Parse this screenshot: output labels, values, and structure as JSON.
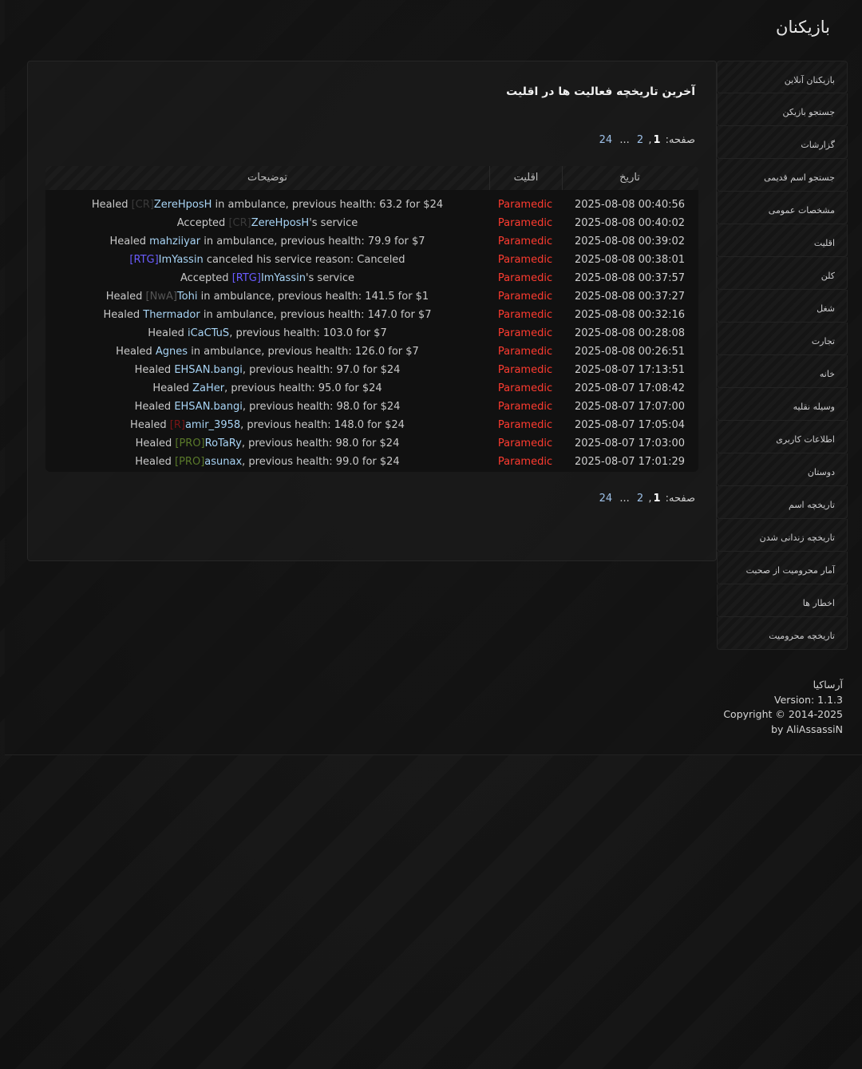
{
  "page": {
    "title": "بازیکنان"
  },
  "main": {
    "heading": "آخرین تاریخچه فعالیت ها در اقلیت",
    "pagination": {
      "label": "صفحه:",
      "current": "1",
      "comma": ",",
      "next": "2",
      "ellipsis": "...",
      "last": "24"
    },
    "table": {
      "headers": {
        "desc": "توضیحات",
        "faction": "اقلیت",
        "date": "تاریخ"
      },
      "rows": [
        {
          "parts": [
            {
              "t": "Healed "
            },
            {
              "t": "[CR]",
              "c": "#3a3a3a"
            },
            {
              "t": "ZereHposH",
              "c": "#a8d4f5"
            },
            {
              "t": " in ambulance, previous health: 63.2 for $24"
            }
          ],
          "faction": "Paramedic",
          "date": "2025-08-08 00:40:56"
        },
        {
          "parts": [
            {
              "t": "Accepted "
            },
            {
              "t": "[CR]",
              "c": "#3a3a3a"
            },
            {
              "t": "ZereHposH",
              "c": "#a8d4f5"
            },
            {
              "t": "'s service"
            }
          ],
          "faction": "Paramedic",
          "date": "2025-08-08 00:40:02"
        },
        {
          "parts": [
            {
              "t": "Healed "
            },
            {
              "t": "mahziiyar",
              "c": "#a8d4f5"
            },
            {
              "t": " in ambulance, previous health: 79.9 for $7"
            }
          ],
          "faction": "Paramedic",
          "date": "2025-08-08 00:39:02"
        },
        {
          "parts": [
            {
              "t": "[RTG]",
              "c": "#6a5cff"
            },
            {
              "t": "ImYassin",
              "c": "#a8d4f5"
            },
            {
              "t": " canceled his service reason: Canceled"
            }
          ],
          "faction": "Paramedic",
          "date": "2025-08-08 00:38:01"
        },
        {
          "parts": [
            {
              "t": "Accepted "
            },
            {
              "t": "[RTG]",
              "c": "#6a5cff"
            },
            {
              "t": "ImYassin",
              "c": "#a8d4f5"
            },
            {
              "t": "'s service"
            }
          ],
          "faction": "Paramedic",
          "date": "2025-08-08 00:37:57"
        },
        {
          "parts": [
            {
              "t": "Healed "
            },
            {
              "t": "[NwA]",
              "c": "#555555"
            },
            {
              "t": "Tohi",
              "c": "#a8d4f5"
            },
            {
              "t": " in ambulance, previous health: 141.5 for $1"
            }
          ],
          "faction": "Paramedic",
          "date": "2025-08-08 00:37:27"
        },
        {
          "parts": [
            {
              "t": "Healed "
            },
            {
              "t": "Thermador",
              "c": "#a8d4f5"
            },
            {
              "t": " in ambulance, previous health: 147.0 for $7"
            }
          ],
          "faction": "Paramedic",
          "date": "2025-08-08 00:32:16"
        },
        {
          "parts": [
            {
              "t": "Healed "
            },
            {
              "t": "iCaCTuS",
              "c": "#a8d4f5"
            },
            {
              "t": ", previous health: 103.0 for $7"
            }
          ],
          "faction": "Paramedic",
          "date": "2025-08-08 00:28:08"
        },
        {
          "parts": [
            {
              "t": "Healed "
            },
            {
              "t": "Agnes",
              "c": "#a8d4f5"
            },
            {
              "t": " in ambulance, previous health: 126.0 for $7"
            }
          ],
          "faction": "Paramedic",
          "date": "2025-08-08 00:26:51"
        },
        {
          "parts": [
            {
              "t": "Healed "
            },
            {
              "t": "EHSAN.bangi",
              "c": "#a8d4f5"
            },
            {
              "t": ", previous health: 97.0 for $24"
            }
          ],
          "faction": "Paramedic",
          "date": "2025-08-07 17:13:51"
        },
        {
          "parts": [
            {
              "t": "Healed "
            },
            {
              "t": "ZaHer",
              "c": "#a8d4f5"
            },
            {
              "t": ", previous health: 95.0 for $24"
            }
          ],
          "faction": "Paramedic",
          "date": "2025-08-07 17:08:42"
        },
        {
          "parts": [
            {
              "t": "Healed "
            },
            {
              "t": "EHSAN.bangi",
              "c": "#a8d4f5"
            },
            {
              "t": ", previous health: 98.0 for $24"
            }
          ],
          "faction": "Paramedic",
          "date": "2025-08-07 17:07:00"
        },
        {
          "parts": [
            {
              "t": "Healed "
            },
            {
              "t": "[R]",
              "c": "#7a1414"
            },
            {
              "t": "amir_3958",
              "c": "#a8d4f5"
            },
            {
              "t": ", previous health: 148.0 for $24"
            }
          ],
          "faction": "Paramedic",
          "date": "2025-08-07 17:05:04"
        },
        {
          "parts": [
            {
              "t": "Healed "
            },
            {
              "t": "[PRO]",
              "c": "#5a7a2a"
            },
            {
              "t": "RoTaRy",
              "c": "#a8d4f5"
            },
            {
              "t": ", previous health: 98.0 for $24"
            }
          ],
          "faction": "Paramedic",
          "date": "2025-08-07 17:03:00"
        },
        {
          "parts": [
            {
              "t": "Healed "
            },
            {
              "t": "[PRO]",
              "c": "#5a7a2a"
            },
            {
              "t": "asunax",
              "c": "#a8d4f5"
            },
            {
              "t": ", previous health: 99.0 for $24"
            }
          ],
          "faction": "Paramedic",
          "date": "2025-08-07 17:01:29"
        }
      ]
    }
  },
  "sidebar": {
    "items": [
      {
        "label": "بازیکنان آنلاین"
      },
      {
        "label": "جستجو بازیکن"
      },
      {
        "label": "گزارشات"
      },
      {
        "label": "جستجو اسم قدیمی"
      },
      {
        "label": "مشخصات عمومی"
      },
      {
        "label": "اقلیت"
      },
      {
        "label": "کلن"
      },
      {
        "label": "شغل"
      },
      {
        "label": "تجارت"
      },
      {
        "label": "خانه"
      },
      {
        "label": "وسیله نقلیه"
      },
      {
        "label": "اطلاعات کاربری"
      },
      {
        "label": "دوستان"
      },
      {
        "label": "تاریخچه اسم"
      },
      {
        "label": "تاریخچه زندانی شدن"
      },
      {
        "label": "آمار محرومیت از صحبت"
      },
      {
        "label": "اخطار ها"
      },
      {
        "label": "تاریخچه محرومیت"
      }
    ]
  },
  "footer": {
    "brand": "آرساکیا",
    "version": "Version: 1.1.3",
    "copyright": "Copyright © 2014-2025",
    "author": "by AliAssassiN"
  },
  "colors": {
    "faction_red": "#ff3b30",
    "player_name": "#a8d4f5",
    "link_blue": "#9ec1e8"
  }
}
